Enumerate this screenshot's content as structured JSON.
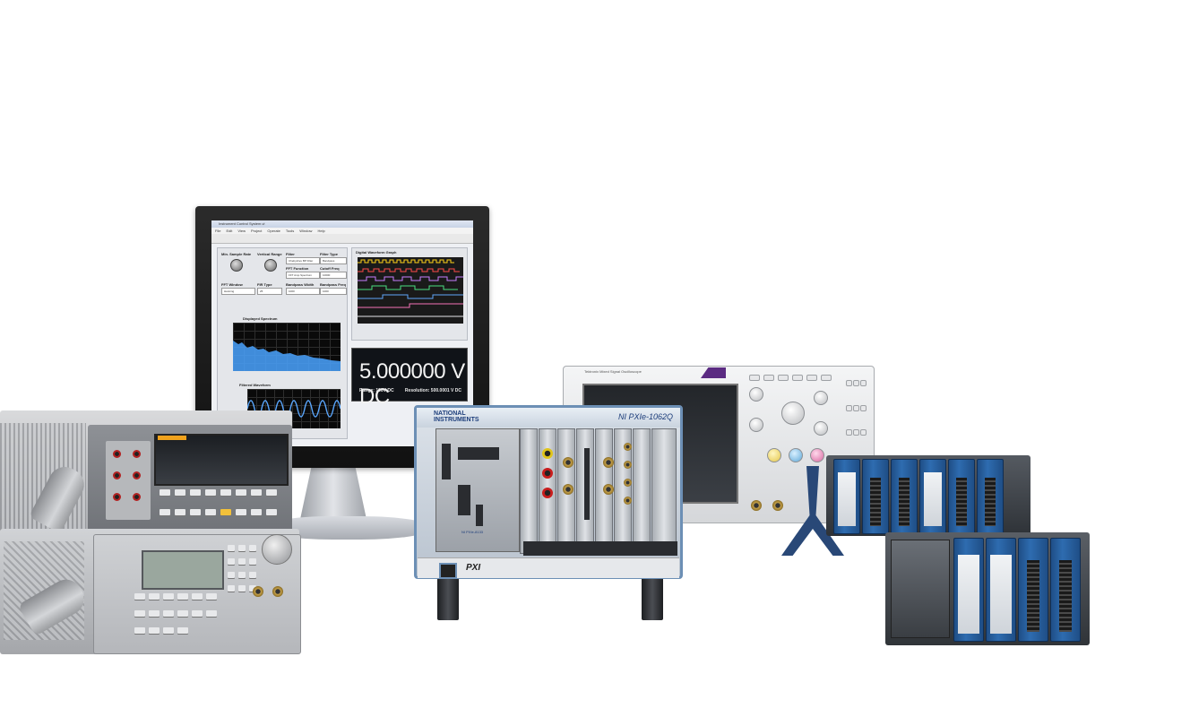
{
  "monitor": {
    "window_title": "Instrument Control System.vi",
    "menu": [
      "File",
      "Edit",
      "View",
      "Project",
      "Operate",
      "Tools",
      "Window",
      "Help"
    ],
    "controls": {
      "sample_rate_label": "Min. Sample Rate",
      "vertical_range_label": "Vertical Range",
      "filter_label": "Filter",
      "filter_value": "Chebyshev BP Filter",
      "filter_type_label": "Filter Type",
      "filter_type_value": "Bandpass",
      "fft_function_label": "FFT Function",
      "fft_function_value": "FFT Amp Spectrum",
      "cutoff_label": "Cutoff Freq",
      "cutoff_value": "10000",
      "fft_window_label": "FFT Window",
      "fft_window_value": "Hanning",
      "fir_type_label": "FIR Type",
      "fir_type_value": "25",
      "bandpass_width_label": "Bandpass Width",
      "bandpass_width_value": "1000",
      "bandpass_freq_label": "Bandpass Freq",
      "bandpass_freq_value": "1000"
    },
    "spectrum_title": "Displayed Spectrum",
    "filtered_title": "Filtered Waveform",
    "digital_title": "Digital Waveform Graph",
    "dmm": {
      "readout": "5.000000  V DC",
      "range": "Range: 100V DC",
      "resolution": "Resolution: 500.0001 V DC"
    }
  },
  "pxi": {
    "brand_line1": "NATIONAL",
    "brand_line2": "INSTRUMENTS",
    "model": "NI PXIe-1062Q",
    "logo": "PXI",
    "controller": "NI PXIe-8133"
  },
  "scope": {
    "brand": "Tektronix",
    "name": "Mixed Signal Oscilloscope"
  },
  "colors": {
    "ni_blue": "#1c3d7a",
    "chassis_trim": "#6c8fb5",
    "module_blue": "#2e6cb0",
    "dmm_accent": "#f0a21c",
    "spectrum_trace": "#4aa3ff",
    "filtered_trace": "#5aa7ff"
  }
}
